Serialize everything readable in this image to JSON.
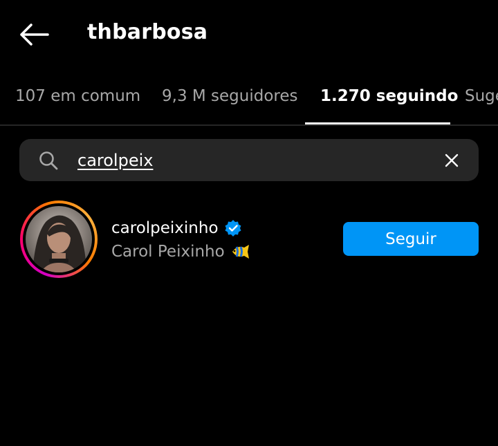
{
  "header": {
    "title": "thbarbosa"
  },
  "tabs": [
    {
      "label": "107 em comum"
    },
    {
      "label": "9,3 M seguidores"
    },
    {
      "label": "1.270 seguindo"
    },
    {
      "label": "Suge"
    }
  ],
  "active_tab_index": 2,
  "search": {
    "value": "carolpeix"
  },
  "results": [
    {
      "username": "carolpeixinho",
      "full_name": "Carol Peixinho",
      "verified": true,
      "name_emoji": "fish-emoji",
      "follow_label": "Seguir"
    }
  ],
  "colors": {
    "background": "#000000",
    "accent": "#0095f6",
    "secondary_text": "#a8a8a8",
    "search_bg": "#262626"
  }
}
